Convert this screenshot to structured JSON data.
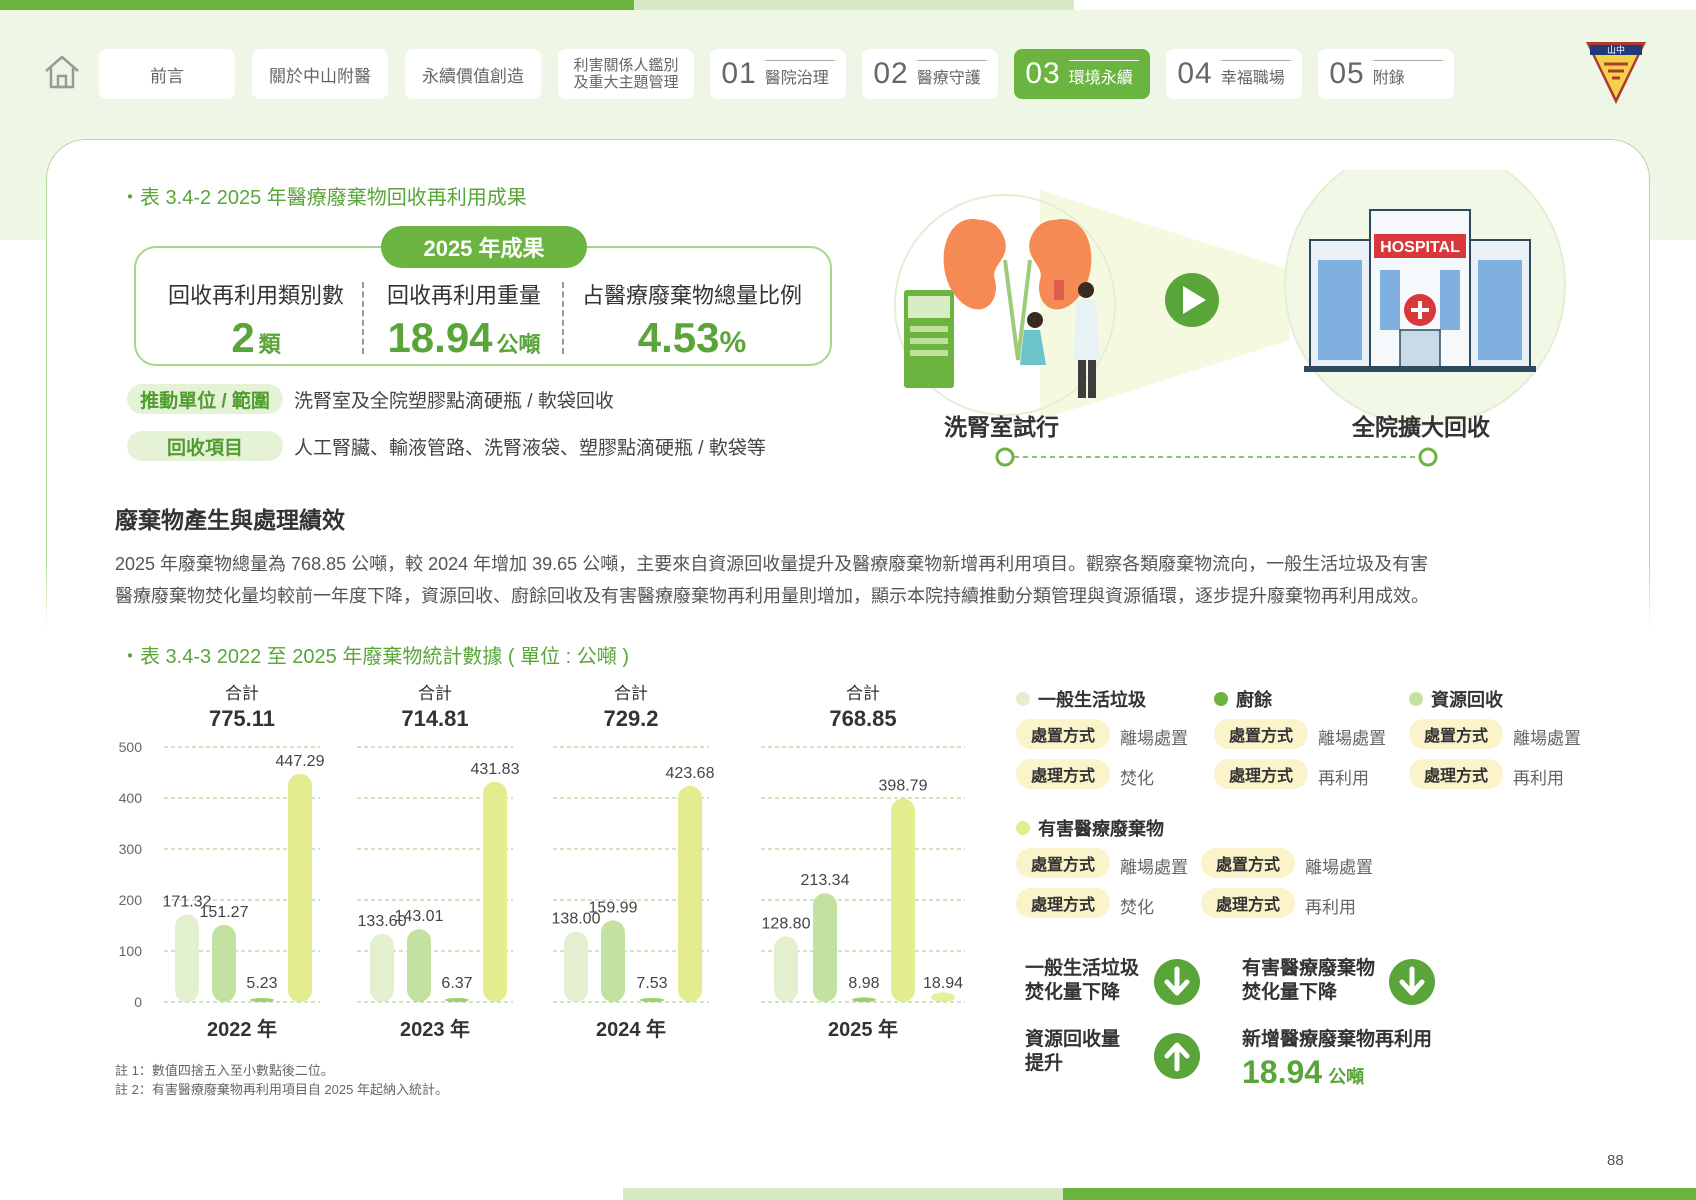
{
  "nav": {
    "items": [
      {
        "label": "前言"
      },
      {
        "label": "關於中山附醫"
      },
      {
        "label": "永續價值創造"
      },
      {
        "label_line1": "利害關係人鑑別",
        "label_line2": "及重大主題管理"
      },
      {
        "num": "01",
        "label": "醫院治理"
      },
      {
        "num": "02",
        "label": "醫療守護"
      },
      {
        "num": "03",
        "label": "環境永續",
        "active": true
      },
      {
        "num": "04",
        "label": "幸福職場"
      },
      {
        "num": "05",
        "label": "附錄"
      }
    ],
    "logo_text": "山中"
  },
  "table1": {
    "title": "表 3.4-2 2025 年醫療廢棄物回收再利用成果",
    "badge": "2025 年成果",
    "cols": [
      {
        "head": "回收再利用類別數",
        "value": "2",
        "unit": "類"
      },
      {
        "head": "回收再利用重量",
        "value": "18.94",
        "unit": "公噸"
      },
      {
        "head": "占醫療廢棄物總量比例",
        "value": "4.53",
        "unit": "%"
      }
    ],
    "scope_label": "推動單位 / 範圍",
    "scope_text": "洗腎室及全院塑膠點滴硬瓶 / 軟袋回收",
    "items_label": "回收項目",
    "items_text": "人工腎臟、輸液管路、洗腎液袋、塑膠點滴硬瓶 / 軟袋等"
  },
  "illustration": {
    "left_caption": "洗腎室試行",
    "right_caption": "全院擴大回收",
    "hospital_sign": "HOSPITAL"
  },
  "section": {
    "title": "廢棄物產生與處理績效",
    "para_line1": "2025 年廢棄物總量為 768.85 公噸，較 2024 年增加 39.65 公噸，主要來自資源回收量提升及醫療廢棄物新增再利用項目。觀察各類廢棄物流向，一般生活垃圾及有害",
    "para_line2": "醫療廢棄物焚化量均較前一年度下降，資源回收、廚餘回收及有害醫療廢棄物再利用量則增加，顯示本院持續推動分類管理與資源循環，逐步提升廢棄物再利用成效。"
  },
  "table2": {
    "title": "表 3.4-3 2022 至 2025 年廢棄物統計數據 ( 單位 : 公噸 )",
    "total_label": "合計",
    "note1": "註 1：數值四捨五入至小數點後二位。",
    "note2": "註 2：有害醫療廢棄物再利用項目自 2025 年起納入統計。"
  },
  "chart_data": {
    "type": "bar",
    "categories": [
      "2022 年",
      "2023 年",
      "2024 年",
      "2025 年"
    ],
    "totals": [
      "775.11",
      "714.81",
      "729.2",
      "768.85"
    ],
    "ylim": [
      0,
      500
    ],
    "yticks": [
      "0",
      "100",
      "200",
      "300",
      "400",
      "500"
    ],
    "grid": true,
    "series": [
      {
        "name": "一般生活垃圾",
        "color": "#e2f0cf",
        "values": [
          171.32,
          133.6,
          138.0,
          128.8
        ],
        "labels": [
          "171.32",
          "133.60",
          "138.00",
          "128.80"
        ]
      },
      {
        "name": "廚餘",
        "color": "#c3e2a1",
        "values": [
          151.27,
          143.01,
          159.99,
          213.34
        ],
        "labels": [
          "151.27",
          "143.01",
          "159.99",
          "213.34"
        ]
      },
      {
        "name": "有害醫療廢棄物",
        "color": "#9fcf6f",
        "values": [
          5.23,
          6.37,
          7.53,
          8.98
        ],
        "labels": [
          "5.23",
          "6.37",
          "7.53",
          "8.98"
        ]
      },
      {
        "name": "資源回收",
        "color": "#e3ec8e",
        "values": [
          447.29,
          431.83,
          423.68,
          398.79
        ],
        "labels": [
          "447.29",
          "431.83",
          "423.68",
          "398.79"
        ]
      },
      {
        "name": "有害醫療廢棄物再利用",
        "color": "#e8ef9a",
        "values": [
          null,
          null,
          null,
          18.94
        ],
        "labels": [
          "",
          "",
          "",
          "18.94"
        ]
      }
    ]
  },
  "legend": {
    "general": {
      "name": "一般生活垃圾",
      "color": "#e2f0cf",
      "k1": "處置方式",
      "v1": "離場處置",
      "k2": "處理方式",
      "v2": "焚化"
    },
    "food": {
      "name": "廚餘",
      "color": "#6ab43f",
      "k1": "處置方式",
      "v1": "離場處置",
      "k2": "處理方式",
      "v2": "再利用"
    },
    "resource": {
      "name": "資源回收",
      "color": "#c3e2a1",
      "k1": "處置方式",
      "v1": "離場處置",
      "k2": "處理方式",
      "v2": "再利用"
    },
    "hazard": {
      "name": "有害醫療廢棄物",
      "color": "#e3ec8e",
      "k1": "處置方式",
      "v1": "離場處置",
      "k2": "處理方式",
      "v2": "焚化",
      "k3": "處置方式",
      "v3": "離場處置",
      "k4": "處理方式",
      "v4": "再利用"
    }
  },
  "summary": {
    "a_line1": "一般生活垃圾",
    "a_line2": "焚化量下降",
    "b_line1": "有害醫療廢棄物",
    "b_line2": "焚化量下降",
    "c_line1": "資源回收量",
    "c_line2": "提升",
    "d_line1": "新增醫療廢棄物再利用",
    "d_value": "18.94",
    "d_unit": "公噸"
  },
  "page_number": "88",
  "colors": {
    "brand_green": "#6ab43f",
    "light_green": "#d6e9c4",
    "text_green": "#5aa53a"
  }
}
